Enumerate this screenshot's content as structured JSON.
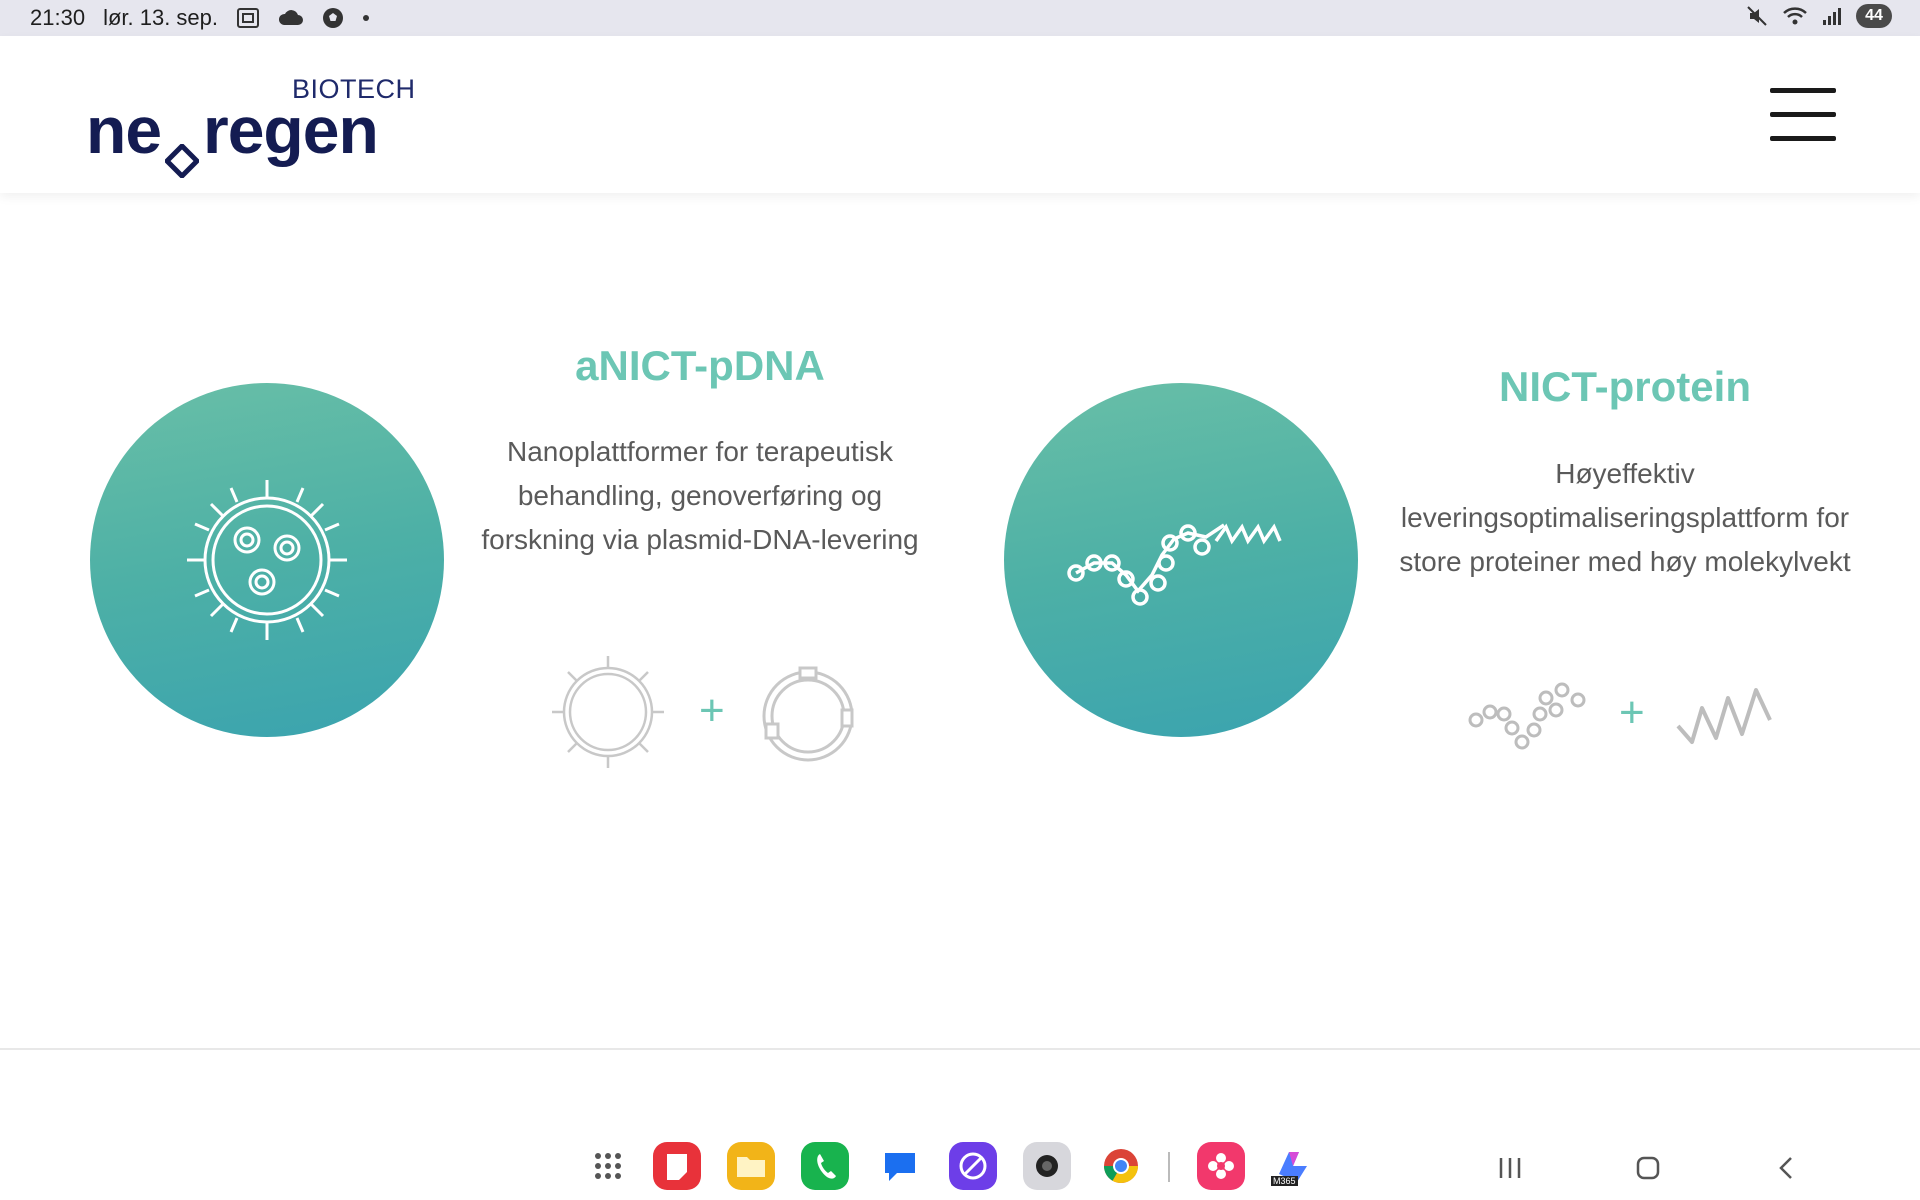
{
  "status_bar": {
    "time": "21:30",
    "date": "lør. 13. sep.",
    "battery": "44",
    "icons": [
      "screenshot-icon",
      "cloud-icon",
      "football-icon",
      "dot-icon",
      "mute-icon",
      "wifi-icon",
      "signal-icon"
    ]
  },
  "header": {
    "logo_biotech": "BIOTECH",
    "logo_word_left": "ne",
    "logo_word_right": "regen",
    "menu_icon": "hamburger-menu-icon"
  },
  "products": [
    {
      "title": "aNICT-pDNA",
      "description": "Nanoplattformer for terapeutisk behandling, genoverføring og forskning via plasmid-DNA-levering",
      "circle_icon": "nanoparticle-cell-icon",
      "formula_left_icon": "nanoparticle-outline-icon",
      "formula_plus": "+",
      "formula_right_icon": "plasmid-ring-icon"
    },
    {
      "title": "NICT-protein",
      "description": "Høyeffektiv leveringsoptimaliseringsplattform for store proteiner med høy molekylvekt",
      "circle_icon": "protein-chain-icon",
      "formula_left_icon": "protein-chain-outline-icon",
      "formula_plus": "+",
      "formula_right_icon": "helix-ribbon-icon"
    }
  ],
  "taskbar": {
    "apps": [
      "app-drawer-icon",
      "notes-app-icon",
      "files-app-icon",
      "phone-app-icon",
      "messages-app-icon",
      "internet-app-icon",
      "camera-app-icon",
      "chrome-app-icon",
      "gallery-app-icon",
      "m365-app-icon"
    ],
    "m365_label": "M365",
    "nav": [
      "recents-nav-icon",
      "home-nav-icon",
      "back-nav-icon"
    ]
  },
  "colors": {
    "accent": "#6cc6b4",
    "circle_top": "#69bfa7",
    "circle_bottom": "#3aa3af",
    "logo_navy": "#141c52",
    "text_gray": "#5a5a5a"
  }
}
